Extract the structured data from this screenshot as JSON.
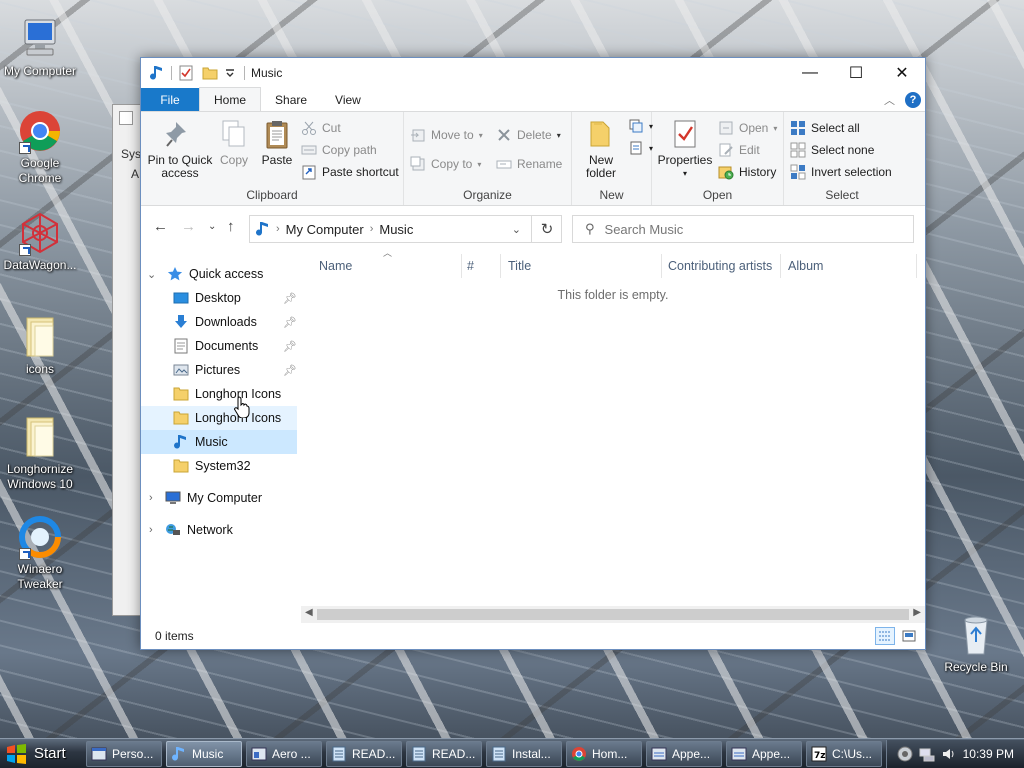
{
  "desktop": {
    "icons": [
      {
        "label": "My Computer",
        "icon": "computer-icon"
      },
      {
        "label": "Google Chrome",
        "icon": "chrome-icon"
      },
      {
        "label": "DataWagon...",
        "icon": "datawagon-icon"
      },
      {
        "label": "icons",
        "icon": "folder-icon"
      },
      {
        "label": "Longhornize Windows 10",
        "icon": "folder-icon"
      },
      {
        "label": "Winaero Tweaker",
        "icon": "winaero-icon"
      },
      {
        "label": "Recycle Bin",
        "icon": "recycle-bin-icon"
      }
    ],
    "background_window_fragments": [
      "Sys",
      "A"
    ]
  },
  "window": {
    "title": "Music",
    "controls": {
      "minimize": "—",
      "maximize": "☐",
      "close": "✕"
    }
  },
  "ribbon": {
    "tabs": [
      "File",
      "Home",
      "Share",
      "View"
    ],
    "active_tab": "Home",
    "groups": {
      "clipboard": {
        "label": "Clipboard",
        "pin": "Pin to Quick access",
        "copy": "Copy",
        "paste": "Paste",
        "cut": "Cut",
        "copy_path": "Copy path",
        "paste_shortcut": "Paste shortcut"
      },
      "organize": {
        "label": "Organize",
        "move_to": "Move to",
        "copy_to": "Copy to",
        "delete": "Delete",
        "rename": "Rename"
      },
      "new": {
        "label": "New",
        "new_folder": "New folder"
      },
      "open": {
        "label": "Open",
        "properties": "Properties",
        "open": "Open",
        "edit": "Edit",
        "history": "History"
      },
      "select": {
        "label": "Select",
        "select_all": "Select all",
        "select_none": "Select none",
        "invert": "Invert selection"
      }
    }
  },
  "address": {
    "crumbs": [
      "My Computer",
      "Music"
    ],
    "search_placeholder": "Search Music"
  },
  "nav": {
    "quick_access": "Quick access",
    "items": [
      {
        "label": "Desktop",
        "pinned": true
      },
      {
        "label": "Downloads",
        "pinned": true
      },
      {
        "label": "Documents",
        "pinned": true
      },
      {
        "label": "Pictures",
        "pinned": true
      },
      {
        "label": "Longhorn Icons",
        "pinned": false
      },
      {
        "label": "Longhorn Icons",
        "pinned": false
      },
      {
        "label": "Music",
        "pinned": false
      },
      {
        "label": "System32",
        "pinned": false
      }
    ],
    "my_computer": "My Computer",
    "network": "Network"
  },
  "content": {
    "columns": [
      "Name",
      "#",
      "Title",
      "Contributing artists",
      "Album"
    ],
    "empty_message": "This folder is empty."
  },
  "status": {
    "items": "0 items"
  },
  "taskbar": {
    "start": "Start",
    "tasks": [
      "Perso...",
      "Music",
      "Aero ...",
      "READ...",
      "READ...",
      "Instal...",
      "Hom...",
      "Appe...",
      "Appe...",
      "C:\\Us..."
    ],
    "active_task": "Music",
    "clock": "10:39 PM"
  },
  "colors": {
    "accent": "#1979ca",
    "selection": "#cce8ff",
    "folder": "#f5d06a"
  }
}
